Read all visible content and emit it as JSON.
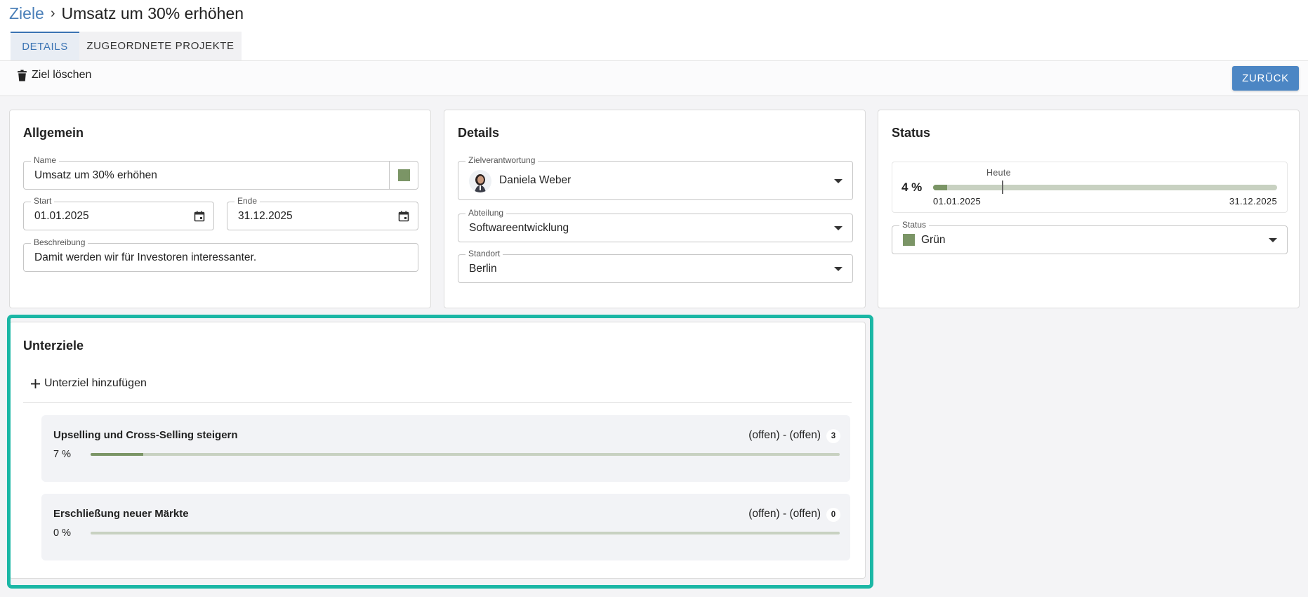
{
  "breadcrumb": {
    "root": "Ziele",
    "separator": "›",
    "current": "Umsatz um 30% erhöhen"
  },
  "tabs": [
    {
      "label": "DETAILS",
      "active": true
    },
    {
      "label": "ZUGEORDNETE PROJEKTE",
      "active": false
    }
  ],
  "toolbar": {
    "delete_label": "Ziel löschen",
    "delete_icon": "trash-icon",
    "back_label": "ZURÜCK"
  },
  "allgemein": {
    "title": "Allgemein",
    "name_label": "Name",
    "name_value": "Umsatz um 30% erhöhen",
    "color": "#7b9566",
    "start_label": "Start",
    "start_value": "01.01.2025",
    "end_label": "Ende",
    "end_value": "31.12.2025",
    "desc_label": "Beschreibung",
    "desc_value": "Damit werden wir für Investoren interessanter."
  },
  "details": {
    "title": "Details",
    "owner_label": "Zielverantwortung",
    "owner_value": "Daniela Weber",
    "dept_label": "Abteilung",
    "dept_value": "Softwareentwicklung",
    "loc_label": "Standort",
    "loc_value": "Berlin"
  },
  "status": {
    "title": "Status",
    "progress_label": "4 %",
    "progress_fraction": 0.04,
    "today_label": "Heute",
    "today_fraction": 0.2,
    "start_date": "01.01.2025",
    "end_date": "31.12.2025",
    "status_label": "Status",
    "status_value": "Grün",
    "status_color": "#7b9566"
  },
  "unterziele": {
    "title": "Unterziele",
    "add_label": "Unterziel hinzufügen",
    "add_icon": "plus-icon",
    "items": [
      {
        "title": "Upselling und Cross-Selling steigern",
        "dates": "(offen) - (offen)",
        "count": "3",
        "pct_label": "7 %",
        "fraction": 0.07
      },
      {
        "title": "Erschließung neuer Märkte",
        "dates": "(offen) - (offen)",
        "count": "0",
        "pct_label": "0 %",
        "fraction": 0.0
      }
    ]
  },
  "colors": {
    "accent": "#3a73b3",
    "button": "#4c86c4",
    "green": "#7b9566",
    "highlight": "#1bb7a5"
  }
}
